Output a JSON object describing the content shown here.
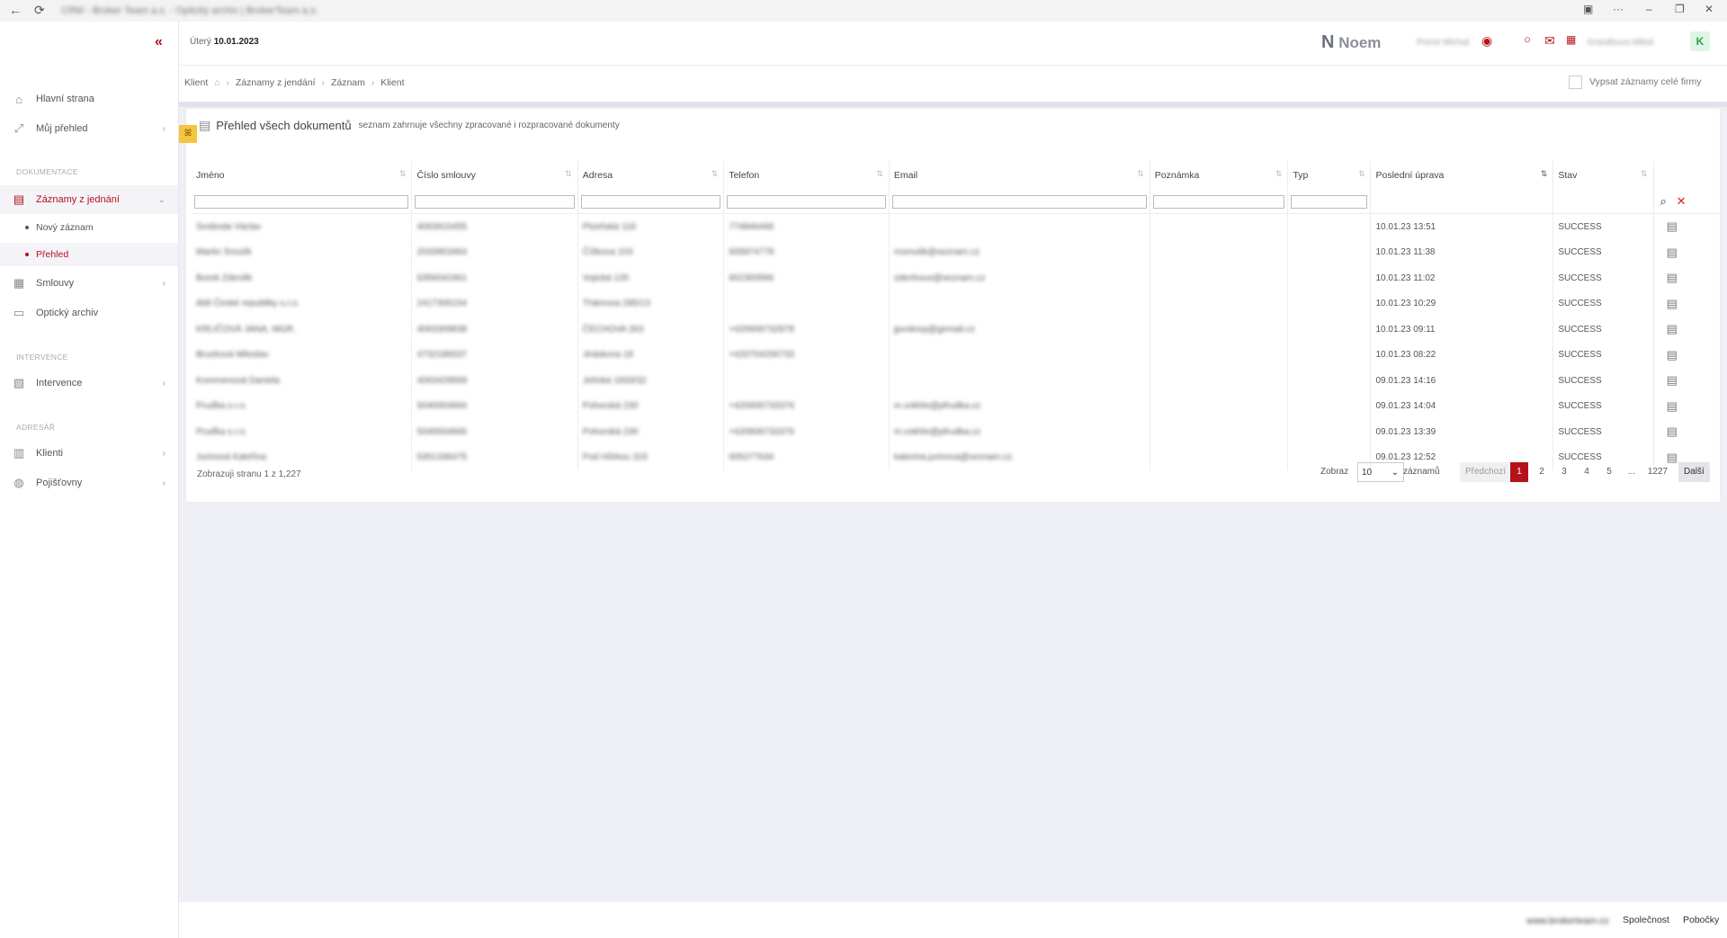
{
  "window": {
    "title": "CRM - Broker Team a.s. - Optický archiv | BrokerTeam a.s."
  },
  "sidebar": {
    "items": [
      {
        "label": "Hlavní strana"
      },
      {
        "label": "Můj přehled"
      },
      {
        "label": "Záznamy z jednání"
      },
      {
        "label": "Smlouvy"
      },
      {
        "label": "Optický archiv"
      },
      {
        "label": "Intervence"
      },
      {
        "label": "Klienti"
      },
      {
        "label": "Pojišťovny"
      }
    ],
    "sections": [
      "DOKUMENTACE",
      "INTERVENCE",
      "ADRESÁŘ"
    ],
    "sub": [
      "Nový záznam",
      "Přehled"
    ]
  },
  "topbar": {
    "day": "Úterý",
    "date": "10.01.2023",
    "logo": "Noem",
    "user1": "Prerie Michal",
    "user2": "Kneidhuns Miloš",
    "avatar": "K"
  },
  "breadcrumb": [
    "Klient",
    "Záznamy z jendání",
    "Záznam",
    "Klient"
  ],
  "checkbox_label": "Vypsat záznamy celé firmy",
  "card": {
    "title": "Přehled všech dokumentů",
    "subtitle": "seznam zahrnuje všechny zpracované i rozpracované dokumenty"
  },
  "table": {
    "headers": [
      "Jméno",
      "Číslo smlouvy",
      "Adresa",
      "Telefon",
      "Email",
      "Poznámka",
      "Typ",
      "Poslední úprava",
      "Stav"
    ],
    "rows": [
      [
        "Svoboda Václav",
        "4063915455",
        "Plzeňská 116",
        "774846466",
        "",
        "",
        "",
        "10.01.23 13:51",
        "SUCCESS"
      ],
      [
        "Martin Smutík",
        "2033953464",
        "Čížkova 103",
        "605874778",
        "msmutik@seznam.cz",
        "",
        "",
        "10.01.23 11:38",
        "SUCCESS"
      ],
      [
        "Borek Zdeněk",
        "6356042461",
        "Vojická 120",
        "602300566",
        "zdenhous@seznam.cz",
        "",
        "",
        "10.01.23 11:02",
        "SUCCESS"
      ],
      [
        "Aldi České republiky s.r.o.",
        "2417306154",
        "Thámova 285/13",
        "",
        "",
        "",
        "",
        "10.01.23 10:29",
        "SUCCESS"
      ],
      [
        "KRLIČOVÁ JANA, MGR.",
        "4063309838",
        "ČECHOVA 263",
        "+420606732878",
        "jpvokrep@gemail.cz",
        "",
        "",
        "10.01.23 09:11",
        "SUCCESS"
      ],
      [
        "Brucková Miloslav",
        "4732186537",
        "Jiráskova 18",
        "+420704256733",
        "",
        "",
        "",
        "10.01.23 08:22",
        "SUCCESS"
      ],
      [
        "Kommenová Daniela",
        "4063429559",
        "Jelínká 1833/32",
        "",
        "",
        "",
        "",
        "09.01.23 14:16",
        "SUCCESS"
      ],
      [
        "Pruďka s.r.o.",
        "5040004664",
        "Pohorská 230",
        "+420606733376",
        "m.vokhlo@pfrudka.cz",
        "",
        "",
        "09.01.23 14:04",
        "SUCCESS"
      ],
      [
        "Pruďka s.r.o.",
        "5040004665",
        "Pohorská 230",
        "+420606733376",
        "m.vokhlo@pfrudka.cz",
        "",
        "",
        "09.01.23 13:39",
        "SUCCESS"
      ],
      [
        "Jurinová Kateřina",
        "5351336475",
        "Pod Hůrkou 315",
        "605277634",
        "katerina.jurinova@seznam.cz",
        "",
        "",
        "09.01.23 12:52",
        "SUCCESS"
      ]
    ]
  },
  "pagination": {
    "info": "Zobrazuji stranu 1 z 1,227",
    "show_label": "Zobraz",
    "page_size": "10",
    "records_label": "záznamů",
    "prev": "Předchozí",
    "pages": [
      "1",
      "2",
      "3",
      "4",
      "5",
      "...",
      "1227"
    ],
    "next": "Další"
  },
  "footer": {
    "site": "www.brokerteam.cz",
    "links": [
      "Společnost",
      "Pobočky"
    ]
  }
}
